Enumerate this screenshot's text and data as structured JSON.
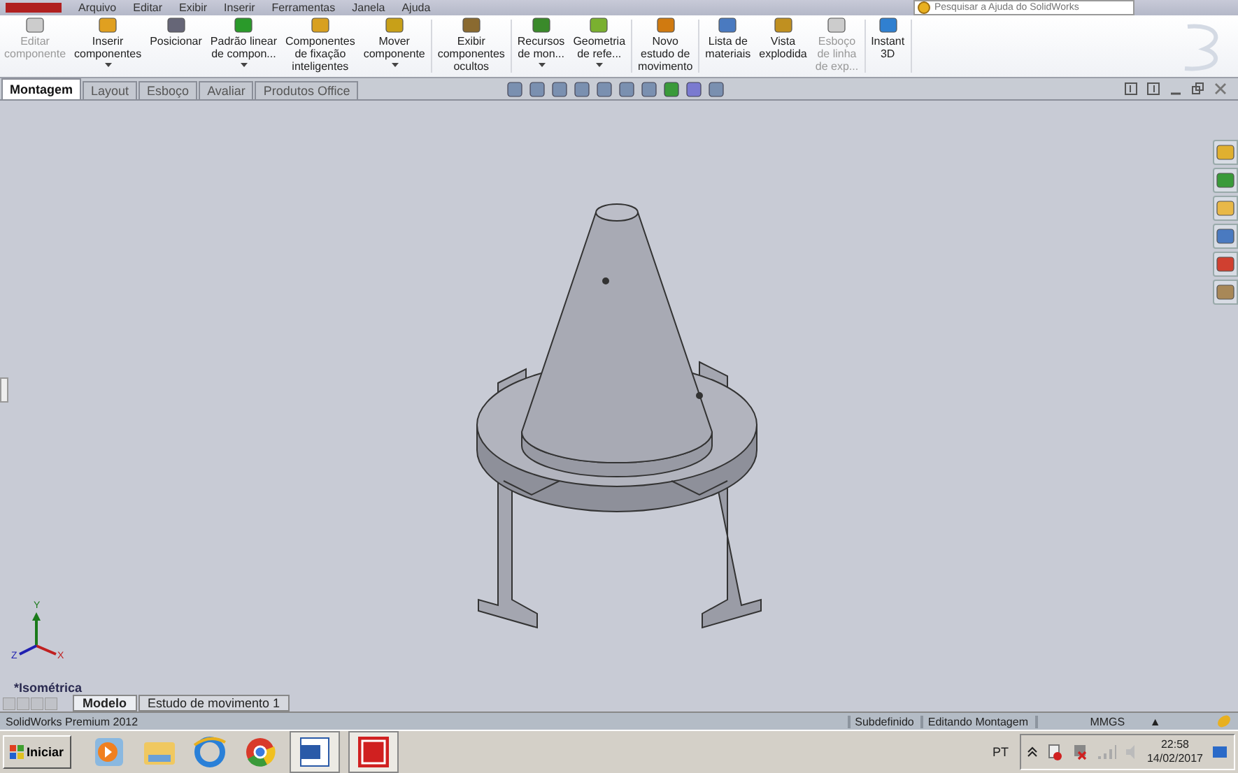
{
  "menu_bar": {
    "items": [
      "Arquivo",
      "Editar",
      "Exibir",
      "Inserir",
      "Ferramentas",
      "Janela",
      "Ajuda"
    ],
    "search": {
      "placeholder": "Pesquisar a Ajuda do SolidWorks"
    }
  },
  "ribbon": {
    "groups": [
      {
        "buttons": [
          {
            "label": "Editar\ncomponente",
            "disabled": true,
            "dropdown": false
          },
          {
            "label": "Inserir\ncomponentes",
            "disabled": false,
            "dropdown": true
          },
          {
            "label": "Posicionar",
            "disabled": false,
            "dropdown": false
          },
          {
            "label": "Padrão linear\nde compon...",
            "disabled": false,
            "dropdown": true
          },
          {
            "label": "Componentes\nde fixação\ninteligentes",
            "disabled": false,
            "dropdown": false
          },
          {
            "label": "Mover\ncomponente",
            "disabled": false,
            "dropdown": true
          }
        ]
      },
      {
        "buttons": [
          {
            "label": "Exibir\ncomponentes\nocultos",
            "disabled": false,
            "dropdown": false
          }
        ]
      },
      {
        "buttons": [
          {
            "label": "Recursos\nde mon...",
            "disabled": false,
            "dropdown": true
          },
          {
            "label": "Geometria\nde refe...",
            "disabled": false,
            "dropdown": true
          }
        ]
      },
      {
        "buttons": [
          {
            "label": "Novo\nestudo de\nmovimento",
            "disabled": false,
            "dropdown": false
          }
        ]
      },
      {
        "buttons": [
          {
            "label": "Lista de\nmateriais",
            "disabled": false,
            "dropdown": false
          },
          {
            "label": "Vista\nexplodida",
            "disabled": false,
            "dropdown": false
          },
          {
            "label": "Esboço\nde linha\nde exp...",
            "disabled": true,
            "dropdown": false
          }
        ]
      },
      {
        "buttons": [
          {
            "label": "Instant\n3D",
            "disabled": false,
            "dropdown": false
          }
        ]
      }
    ]
  },
  "tabs": [
    {
      "label": "Montagem",
      "selected": true
    },
    {
      "label": "Layout",
      "selected": false
    },
    {
      "label": "Esboço",
      "selected": false
    },
    {
      "label": "Avaliar",
      "selected": false
    },
    {
      "label": "Produtos Office",
      "selected": false
    }
  ],
  "viewport": {
    "view_label": "*Isométrica",
    "triad": {
      "x": "X",
      "y": "Y",
      "z": "Z"
    }
  },
  "bottom_tabs": [
    {
      "label": "Modelo",
      "selected": true
    },
    {
      "label": "Estudo de movimento 1",
      "selected": false
    }
  ],
  "status_bar": {
    "product": "SolidWorks Premium 2012",
    "state": "Subdefinido",
    "mode": "Editando Montagem",
    "units": "MMGS",
    "units_caret": "▲"
  },
  "taskbar": {
    "start": "Iniciar",
    "language": "PT",
    "time": "22:58",
    "date": "14/02/2017"
  }
}
